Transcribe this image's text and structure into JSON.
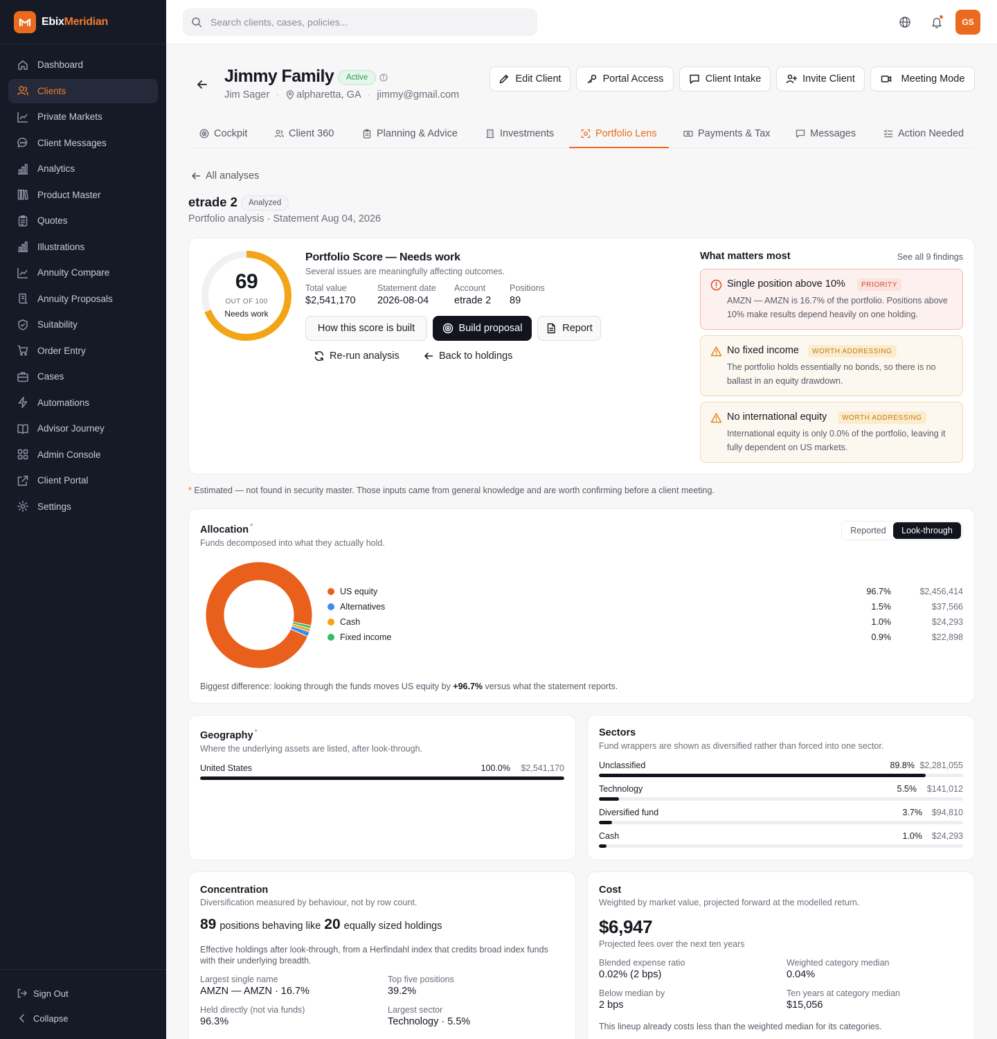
{
  "brand": {
    "name_a": "Ebix",
    "name_b": "Meridian"
  },
  "sidebar": {
    "items": [
      {
        "label": "Dashboard",
        "icon": "home-icon"
      },
      {
        "label": "Clients",
        "icon": "users-icon",
        "active": true
      },
      {
        "label": "Private Markets",
        "icon": "trend-icon"
      },
      {
        "label": "Client Messages",
        "icon": "chat-icon"
      },
      {
        "label": "Analytics",
        "icon": "bar-chart-icon"
      },
      {
        "label": "Product Master",
        "icon": "library-icon"
      },
      {
        "label": "Quotes",
        "icon": "clipboard-icon"
      },
      {
        "label": "Illustrations",
        "icon": "bar-chart-icon"
      },
      {
        "label": "Annuity Compare",
        "icon": "trend-icon"
      },
      {
        "label": "Annuity Proposals",
        "icon": "scroll-icon"
      },
      {
        "label": "Suitability",
        "icon": "shield-icon"
      },
      {
        "label": "Order Entry",
        "icon": "cart-icon"
      },
      {
        "label": "Cases",
        "icon": "briefcase-icon"
      },
      {
        "label": "Automations",
        "icon": "bolt-icon"
      },
      {
        "label": "Advisor Journey",
        "icon": "book-icon"
      },
      {
        "label": "Admin Console",
        "icon": "grid-icon"
      },
      {
        "label": "Client Portal",
        "icon": "external-icon"
      },
      {
        "label": "Settings",
        "icon": "gear-icon"
      }
    ],
    "sign_out": "Sign Out",
    "collapse": "Collapse"
  },
  "topbar": {
    "search_placeholder": "Search clients, cases, policies...",
    "avatar_initials": "GS"
  },
  "client": {
    "name": "Jimmy Family",
    "status": "Active",
    "contact": "Jim Sager",
    "location": "alpharetta, GA",
    "email": "jimmy@gmail.com"
  },
  "header_buttons": {
    "edit": "Edit Client",
    "portal": "Portal Access",
    "intake": "Client Intake",
    "invite": "Invite Client",
    "meeting": "Meeting Mode"
  },
  "tabs": [
    {
      "label": "Cockpit"
    },
    {
      "label": "Client 360"
    },
    {
      "label": "Planning & Advice"
    },
    {
      "label": "Investments"
    },
    {
      "label": "Portfolio Lens",
      "active": true
    },
    {
      "label": "Payments & Tax"
    },
    {
      "label": "Messages"
    },
    {
      "label": "Action Needed"
    }
  ],
  "analysis": {
    "back_label": "All analyses",
    "name": "etrade 2",
    "status": "Analyzed",
    "subtitle": "Portfolio analysis · Statement Aug 04, 2026"
  },
  "score": {
    "value": 69,
    "max": 100,
    "value_text": "69",
    "out_of": "OUT OF 100",
    "label": "Needs work",
    "title": "Portfolio Score — Needs work",
    "description": "Several issues are meaningfully affecting outcomes.",
    "stats": [
      {
        "key": "Total value",
        "value": "$2,541,170"
      },
      {
        "key": "Statement date",
        "value": "2026-08-04"
      },
      {
        "key": "Account",
        "value": "etrade 2"
      },
      {
        "key": "Positions",
        "value": "89"
      }
    ],
    "buttons": {
      "how": "How this score is built",
      "build": "Build proposal",
      "report": "Report",
      "rerun": "Re-run analysis",
      "back": "Back to holdings"
    }
  },
  "what_matters": {
    "title": "What matters most",
    "see_all": "See all 9 findings",
    "findings": [
      {
        "title": "Single position above 10%",
        "tag": "PRIORITY",
        "body": "AMZN — AMZN is 16.7% of the portfolio. Positions above 10% make results depend heavily on one holding."
      },
      {
        "title": "No fixed income",
        "tag": "WORTH ADDRESSING",
        "body": "The portfolio holds essentially no bonds, so there is no ballast in an equity drawdown."
      },
      {
        "title": "No international equity",
        "tag": "WORTH ADDRESSING",
        "body": "International equity is only 0.0% of the portfolio, leaving it fully dependent on US markets."
      }
    ]
  },
  "footnote": {
    "asterisk": "*",
    "text": " Estimated — not found in security master. Those inputs came from general knowledge and are worth confirming before a client meeting."
  },
  "allocation": {
    "title": "Allocation",
    "subtitle": "Funds decomposed into what they actually hold.",
    "toggle": {
      "reported": "Reported",
      "lookthrough": "Look-through"
    },
    "summary_pre": "Biggest difference: looking through the funds moves US equity by ",
    "summary_value": "+96.7%",
    "summary_post": " versus what the statement reports."
  },
  "chart_data": {
    "type": "pie",
    "categories": [
      "US equity",
      "Alternatives",
      "Cash",
      "Fixed income"
    ],
    "values": [
      96.7,
      1.5,
      1.0,
      0.9
    ],
    "percent_labels": [
      "96.7%",
      "1.5%",
      "1.0%",
      "0.9%"
    ],
    "amount_labels": [
      "$2,456,414",
      "$37,566",
      "$24,293",
      "$22,898"
    ],
    "colors": [
      "#e8601c",
      "#3b8ef0",
      "#f2a516",
      "#2fbf68"
    ]
  },
  "geography": {
    "title": "Geography",
    "subtitle": "Where the underlying assets are listed, after look-through.",
    "rows": [
      {
        "label": "United States",
        "pct_text": "100.0%",
        "amount": "$2,541,170",
        "fraction": 1.0
      }
    ]
  },
  "sectors": {
    "title": "Sectors",
    "subtitle": "Fund wrappers are shown as diversified rather than forced into one sector.",
    "rows": [
      {
        "label": "Unclassified",
        "pct_text": "89.8%",
        "amount": "$2,281,055",
        "fraction": 0.898
      },
      {
        "label": "Technology",
        "pct_text": "5.5%",
        "amount": "$141,012",
        "fraction": 0.055
      },
      {
        "label": "Diversified fund",
        "pct_text": "3.7%",
        "amount": "$94,810",
        "fraction": 0.037
      },
      {
        "label": "Cash",
        "pct_text": "1.0%",
        "amount": "$24,293",
        "fraction": 0.01
      }
    ]
  },
  "concentration": {
    "title": "Concentration",
    "subtitle": "Diversification measured by behaviour, not by row count.",
    "positions": "89",
    "mid_text": "positions behaving like",
    "effective": "20",
    "end_text": "equally sized holdings",
    "explain": "Effective holdings after look-through, from a Herfindahl index that credits broad index funds with their underlying breadth.",
    "stats": [
      {
        "key": "Largest single name",
        "value": "AMZN — AMZN · 16.7%"
      },
      {
        "key": "Top five positions",
        "value": "39.2%"
      },
      {
        "key": "Held directly (not via funds)",
        "value": "96.3%"
      },
      {
        "key": "Largest sector",
        "value": "Technology · 5.5%"
      }
    ]
  },
  "cost": {
    "title": "Cost",
    "subtitle": "Weighted by market value, projected forward at the modelled return.",
    "total": "$6,947",
    "total_label": "Projected fees over the next ten years",
    "stats": [
      {
        "key": "Blended expense ratio",
        "value": "0.02% (2 bps)"
      },
      {
        "key": "Weighted category median",
        "value": "0.04%"
      },
      {
        "key": "Below median by",
        "value": "2 bps"
      },
      {
        "key": "Ten years at category median",
        "value": "$15,056"
      }
    ],
    "note": "This lineup already costs less than the weighted median for its categories."
  },
  "colors": {
    "accent": "#ea6a1f",
    "sidebar_bg": "#161a27",
    "score_ring": "#f2a516",
    "dark_button": "#11141c"
  }
}
